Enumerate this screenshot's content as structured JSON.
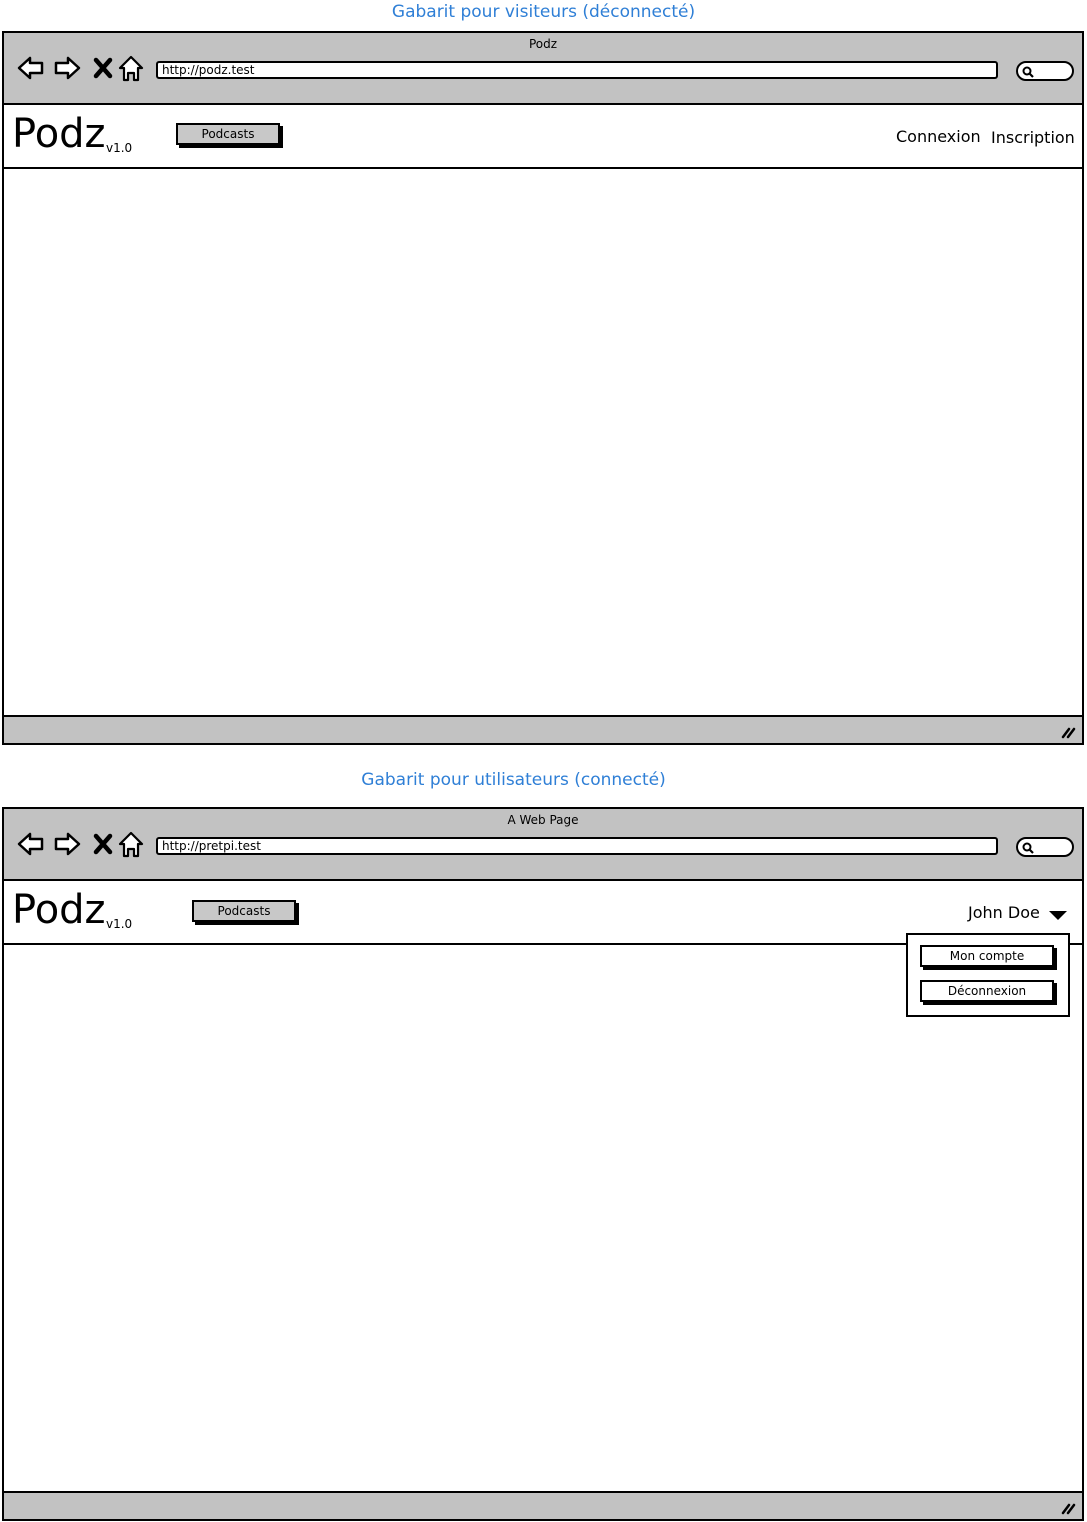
{
  "visitor": {
    "caption": "Gabarit pour visiteurs (déconnecté)",
    "window_title": "Podz",
    "url": "http://podz.test",
    "logo": "Podz",
    "version": "v1.0",
    "nav_button": "Podcasts",
    "links": {
      "login": "Connexion",
      "register": "Inscription"
    }
  },
  "user": {
    "caption": "Gabarit pour utilisateurs (connecté)",
    "window_title": "A Web Page",
    "url": "http://pretpi.test",
    "logo": "Podz",
    "version": "v1.0",
    "nav_button": "Podcasts",
    "user_name": "John Doe",
    "menu": {
      "account": "Mon compte",
      "logout": "Déconnexion"
    }
  },
  "icons": [
    "back-arrow-icon",
    "forward-arrow-icon",
    "close-icon",
    "home-icon",
    "search-icon",
    "resize-grip-icon",
    "caret-down-icon"
  ],
  "colors": {
    "caption": "#2f7fd6",
    "chrome": "#c2c2c2",
    "button": "#c8c8c8"
  }
}
